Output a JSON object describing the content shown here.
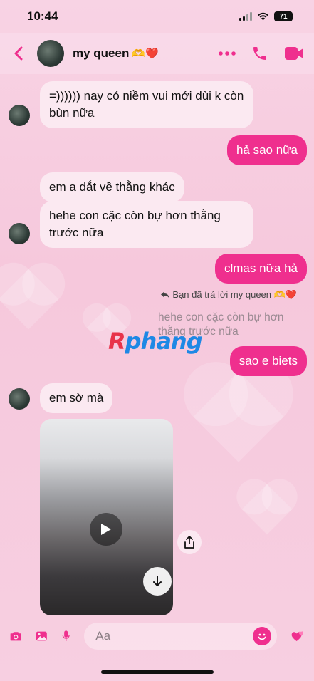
{
  "status_bar": {
    "time": "10:44",
    "battery": "71"
  },
  "header": {
    "contact_name": "my queen",
    "name_emoji": "🫶❤️"
  },
  "messages": [
    {
      "text": "=)))))) nay có niềm vui mới dùi k còn bùn nữa"
    },
    {
      "text": "hả sao nữa"
    },
    {
      "text": "em a dắt về thằng khác"
    },
    {
      "text": "hehe con cặc còn bự hơn thằng trước nữa"
    },
    {
      "text": "clmas nữa hả"
    },
    {
      "text": "sao e biets"
    },
    {
      "text": "em sờ mà"
    }
  ],
  "reply": {
    "note": "Bạn đã trả lời my queen 🫶❤️",
    "quote": "hehe con cặc còn bự hơn thằng trước nữa"
  },
  "watermark": {
    "part1": "R",
    "part2": "phang"
  },
  "composer": {
    "placeholder": "Aa"
  },
  "colors": {
    "accent": "#ef2f8e",
    "incoming_bubble": "#fbe9f1"
  },
  "icons": [
    "back-chevron-icon",
    "more-icon",
    "phone-icon",
    "video-call-icon",
    "camera-icon",
    "gallery-icon",
    "mic-icon",
    "emoji-icon",
    "hearts-icon",
    "play-icon",
    "download-icon",
    "share-icon"
  ]
}
